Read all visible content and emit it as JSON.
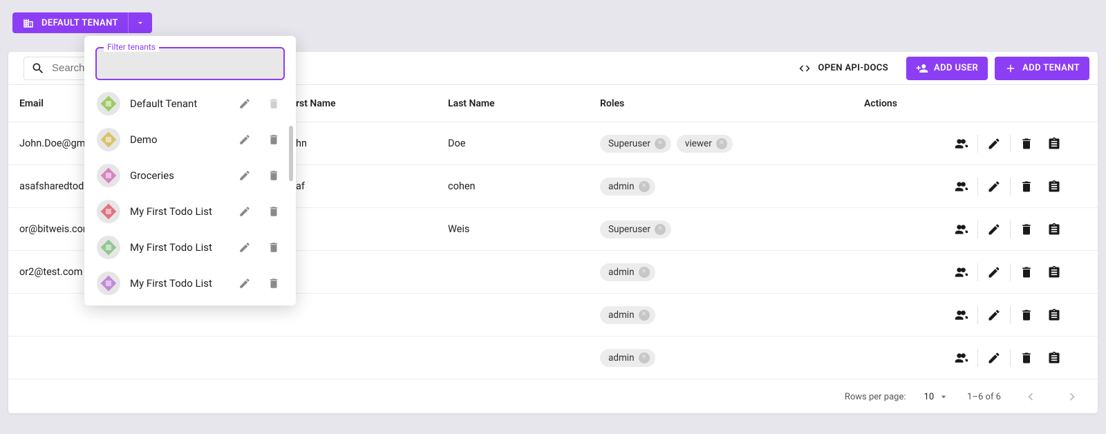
{
  "tenant_selector": {
    "current": "DEFAULT TENANT"
  },
  "search": {
    "placeholder": "Search"
  },
  "toolbar": {
    "api_docs": "OPEN API-DOCS",
    "add_user": "ADD USER",
    "add_tenant": "ADD TENANT"
  },
  "columns": {
    "email": "Email",
    "first_name": "rst Name",
    "last_name": "Last Name",
    "roles": "Roles",
    "actions": "Actions"
  },
  "rows": [
    {
      "email": "John.Doe@gma",
      "first_name": "hn",
      "last_name": "Doe",
      "roles": [
        "Superuser",
        "viewer"
      ]
    },
    {
      "email": "asafsharedtodo",
      "first_name": "af",
      "last_name": "cohen",
      "roles": [
        "admin"
      ]
    },
    {
      "email": "or@bitweis.com",
      "first_name": "",
      "last_name": "Weis",
      "roles": [
        "Superuser"
      ]
    },
    {
      "email": "or2@test.com",
      "first_name": "",
      "last_name": "",
      "roles": [
        "admin"
      ]
    },
    {
      "email": "",
      "first_name": "",
      "last_name": "",
      "roles": [
        "admin"
      ]
    },
    {
      "email": "",
      "first_name": "",
      "last_name": "",
      "roles": [
        "admin"
      ]
    }
  ],
  "pagination": {
    "rows_per_page_label": "Rows per page:",
    "rows_per_page_value": "10",
    "range": "1–6 of 6"
  },
  "popover": {
    "filter_label": "Filter tenants",
    "filter_value": "",
    "tenants": [
      {
        "name": "Default Tenant",
        "can_delete": false,
        "avatar": "a1"
      },
      {
        "name": "Demo",
        "can_delete": true,
        "avatar": "a2"
      },
      {
        "name": "Groceries",
        "can_delete": true,
        "avatar": "a3"
      },
      {
        "name": "My First Todo List",
        "can_delete": true,
        "avatar": "a4"
      },
      {
        "name": "My First Todo List",
        "can_delete": true,
        "avatar": "a5"
      },
      {
        "name": "My First Todo List",
        "can_delete": true,
        "avatar": "a6"
      }
    ]
  },
  "avatar_colors": {
    "a1": "#9ccc65",
    "a2": "#d6c36b",
    "a3": "#d784c3",
    "a4": "#e0737e",
    "a5": "#94c790",
    "a6": "#c389d6"
  }
}
